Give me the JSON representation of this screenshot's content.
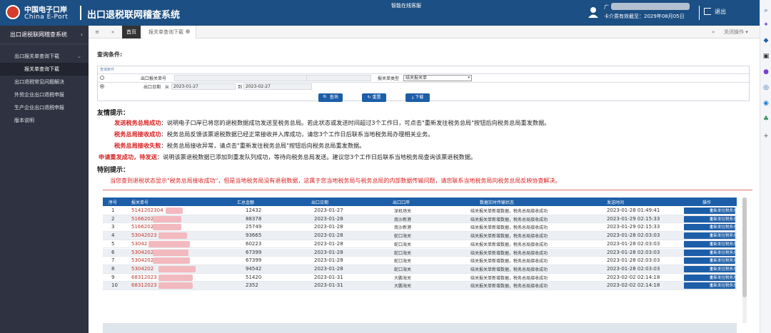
{
  "header": {
    "logo_cn": "中国电子口岸",
    "logo_en": "China E-Port",
    "title": "出口退税联网稽查系统",
    "service": "智能在线客服",
    "user_name": "广",
    "expiry": "卡介质有效截至：2029年08月05日",
    "logout": "退出"
  },
  "sidebar": {
    "title": "出口退税联网稽查系统",
    "items": [
      {
        "label": "出口报关单查询下载",
        "sub": "报关单查询下载"
      },
      {
        "label": "出口退税常见问题解决"
      },
      {
        "label": "外贸企业出口退税申报"
      },
      {
        "label": "生产企业出口退税申报"
      },
      {
        "label": "版本说明"
      }
    ]
  },
  "tabs": {
    "home": "首页",
    "active": "报关单查询下载",
    "close_ops": "关闭操作"
  },
  "query": {
    "label": "查询条件:",
    "caption": "查询条件",
    "row1_label": "出口报关单号",
    "type_label": "报关单类型",
    "type_value": "结关报关单",
    "row2_label": "出口日期",
    "from": "从",
    "date_from": "2023-01-27",
    "to": "到",
    "date_to": "2023-02-27",
    "btn_query": "查询",
    "btn_reset": "重置",
    "btn_download": "下载"
  },
  "tips": {
    "title": "友情提示：",
    "items": [
      {
        "key": "发送税务总局成功",
        "text": "：说明电子口岸已将您的退税数据成功发送至税务总局。若此状态或发送时间超过3个工作日，可点击\"重新发往税务总局\"按钮后向税务总局重发数据。"
      },
      {
        "key": "税务总局接收成功",
        "text": "：税务总局反馈该票退税数据已经正常接收并入库成功，请您3个工作日后联系当地税务局办理相关业务。"
      },
      {
        "key": "税务总局接收失败",
        "text": "：税务总局接收异常，请点击\"重新发往税务总局\"按钮后向税务总局重发数据。"
      },
      {
        "key": "申请重发成功，待发送",
        "text": "：说明该票退税数据已添加到重发队列成功，等待向税务总局发送。建议您3个工作日后联系当地税务局查询该票退税数据。"
      }
    ]
  },
  "special": {
    "title": "特别提示：",
    "text": "当您查到退税状态显示\"税务总局接收成功\"，但是当地税务局没有退税数据，这属于您当地税务局与税务总局的内部数据传输问题，请您联系当地税务局向税务总局反映协查解决。"
  },
  "table": {
    "headers": [
      "序号",
      "报关单号",
      "汇总金额",
      "出口日期",
      "出口口岸",
      "数据实时传输状态",
      "发送时间",
      "操作"
    ],
    "rows": [
      {
        "no": "1",
        "bill": "5141202304",
        "amount": "12432",
        "date": "2023-01-27",
        "port": "深机场关",
        "status": "结关报关单新增数据，税务总局接收成功",
        "time": "2023-01-28 01:49:41",
        "action": "重新发往税务总局"
      },
      {
        "no": "2",
        "bill": "5166202",
        "amount": "88378",
        "date": "2023-01-28",
        "port": "南沙新港",
        "status": "结关报关单新增数据，税务总局接收成功",
        "time": "2023-01-29 02:15:33",
        "action": "重新发往税务总局"
      },
      {
        "no": "3",
        "bill": "5166202",
        "amount": "25749",
        "date": "2023-01-28",
        "port": "南沙新港",
        "status": "结关报关单新增数据，税务总局接收成功",
        "time": "2023-01-29 02:15:33",
        "action": "重新发往税务总局"
      },
      {
        "no": "4",
        "bill": "53042023",
        "amount": "93665",
        "date": "2023-01-28",
        "port": "蛇口海关",
        "status": "结关报关单新增数据，税务总局接收成功",
        "time": "2023-01-28 02:03:03",
        "action": "重新发往税务总局"
      },
      {
        "no": "5",
        "bill": "53042",
        "amount": "60223",
        "date": "2023-01-28",
        "port": "蛇口海关",
        "status": "结关报关单新增数据，税务总局接收成功",
        "time": "2023-01-28 02:03:03",
        "action": "重新发往税务总局"
      },
      {
        "no": "6",
        "bill": "5304202",
        "amount": "67399",
        "date": "2023-01-28",
        "port": "蛇口海关",
        "status": "结关报关单新增数据，税务总局接收成功",
        "time": "2023-01-28 02:03:03",
        "action": "重新发往税务总局"
      },
      {
        "no": "7",
        "bill": "5304202",
        "amount": "67399",
        "date": "2023-01-28",
        "port": "蛇口海关",
        "status": "结关报关单新增数据，税务总局接收成功",
        "time": "2023-01-28 02:03:03",
        "action": "重新发往税务总局"
      },
      {
        "no": "8",
        "bill": "5304202",
        "amount": "94542",
        "date": "2023-01-28",
        "port": "蛇口海关",
        "status": "结关报关单新增数据，税务总局接收成功",
        "time": "2023-01-28 02:03:03",
        "action": "重新发往税务总局"
      },
      {
        "no": "9",
        "bill": "68312023",
        "amount": "51420",
        "date": "2023-01-31",
        "port": "大鹏海关",
        "status": "结关报关单新增数据，税务总局接收成功",
        "time": "2023-02-02 02:14:18",
        "action": "重新发往税务总局"
      },
      {
        "no": "10",
        "bill": "68312023",
        "amount": "2352",
        "date": "2023-01-31",
        "port": "大鹏海关",
        "status": "结关报关单新增数据，税务总局接收成功",
        "time": "2023-02-02 02:14:18",
        "action": "重新发往税务总局"
      }
    ]
  },
  "colors": {
    "header": "#1c4f83",
    "sidebar": "#2f3240",
    "accent": "#1c5ea8",
    "alert": "#d92020"
  }
}
